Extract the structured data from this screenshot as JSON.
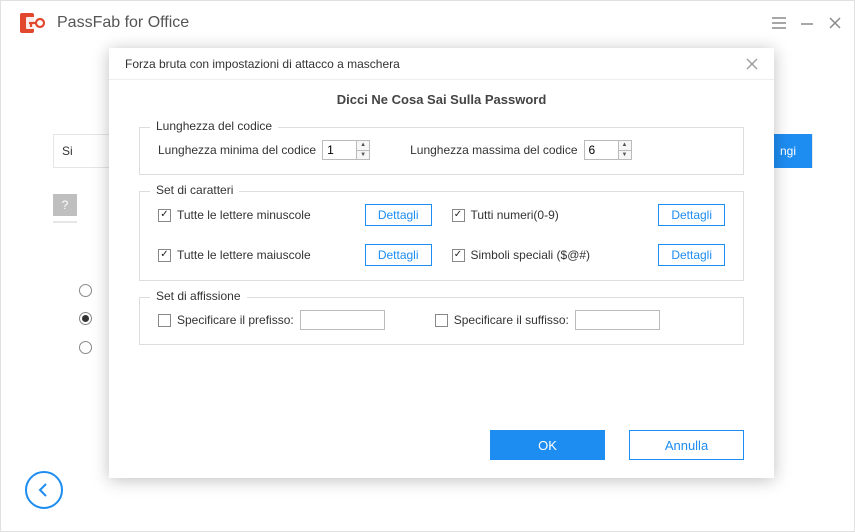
{
  "header": {
    "app_name": "PassFab for Office"
  },
  "background": {
    "row_text": "Si",
    "blue_button": "ngi",
    "question": "?"
  },
  "modal": {
    "title": "Forza bruta con impostazioni di attacco a maschera",
    "subtitle": "Dicci Ne Cosa Sai Sulla Password",
    "length_section": {
      "legend": "Lunghezza del codice",
      "min_label": "Lunghezza minima del codice",
      "min_value": "1",
      "max_label": "Lunghezza massima del codice",
      "max_value": "6"
    },
    "charset_section": {
      "legend": "Set di caratteri",
      "lower": "Tutte le lettere minuscole",
      "upper": "Tutte le lettere maiuscole",
      "numbers": "Tutti numeri(0-9)",
      "symbols": "Simboli speciali ($@#)",
      "details_btn": "Dettagli"
    },
    "affix_section": {
      "legend": "Set di affissione",
      "prefix": "Specificare il prefisso:",
      "suffix": "Specificare il suffisso:"
    },
    "ok": "OK",
    "cancel": "Annulla"
  }
}
